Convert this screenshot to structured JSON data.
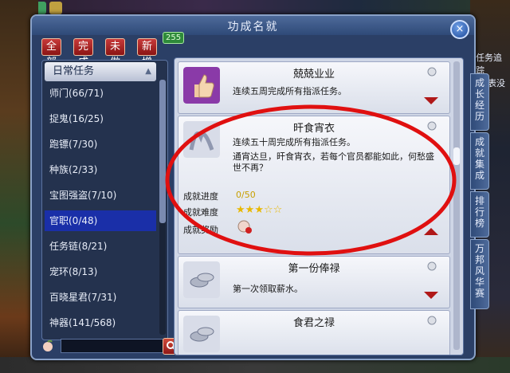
{
  "window": {
    "title": "功成名就",
    "close_label": "×"
  },
  "filters": [
    {
      "label": "全部"
    },
    {
      "label": "完成"
    },
    {
      "label": "未做"
    },
    {
      "label": "新增"
    }
  ],
  "new_badge": "255",
  "categories": {
    "header": "日常任务",
    "items": [
      {
        "label": "师门(66/71)"
      },
      {
        "label": "捉鬼(16/25)"
      },
      {
        "label": "跑镖(7/30)"
      },
      {
        "label": "种族(2/33)"
      },
      {
        "label": "宝图强盗(7/10)"
      },
      {
        "label": "官职(0/48)"
      },
      {
        "label": "任务链(8/21)"
      },
      {
        "label": "宠环(8/13)"
      },
      {
        "label": "百晓星君(7/31)"
      },
      {
        "label": "神器(141/568)"
      }
    ],
    "selected_index": 5
  },
  "search": {
    "placeholder": "",
    "value": ""
  },
  "achievements": [
    {
      "title": "兢兢业业",
      "desc": "连续五周完成所有指派任务。",
      "icon": "thumbs-up-icon"
    },
    {
      "title": "旰食宵衣",
      "desc": "连续五十周完成所有指派任务。",
      "extra": "通宵达旦，旰食宵衣，若每个官员都能如此，何愁盛世不再？",
      "progress_label": "成就进度",
      "progress_value": "0/50",
      "difficulty_label": "成就难度",
      "difficulty_stars": 3,
      "difficulty_max": 5,
      "reward_label": "成就奖励",
      "icon": "silk-scroll-icon"
    },
    {
      "title": "第一份俸禄",
      "desc": "第一次领取薪水。",
      "icon": "silver-ingot-icon"
    },
    {
      "title": "食君之禄",
      "desc": "",
      "icon": "silver-ingot-icon"
    }
  ],
  "side_tabs": [
    {
      "label": "成长经历"
    },
    {
      "label": "成就集成"
    },
    {
      "label": "排行榜"
    },
    {
      "label": "万邦风华赛"
    }
  ],
  "side_notes": {
    "quest_trace": "任务追踪",
    "table_none": "表没"
  },
  "colors": {
    "accent_red": "#b01818",
    "progress_yellow": "#c8a000",
    "star_gold": "#e8b800",
    "selected_blue": "#1a2fa8"
  }
}
